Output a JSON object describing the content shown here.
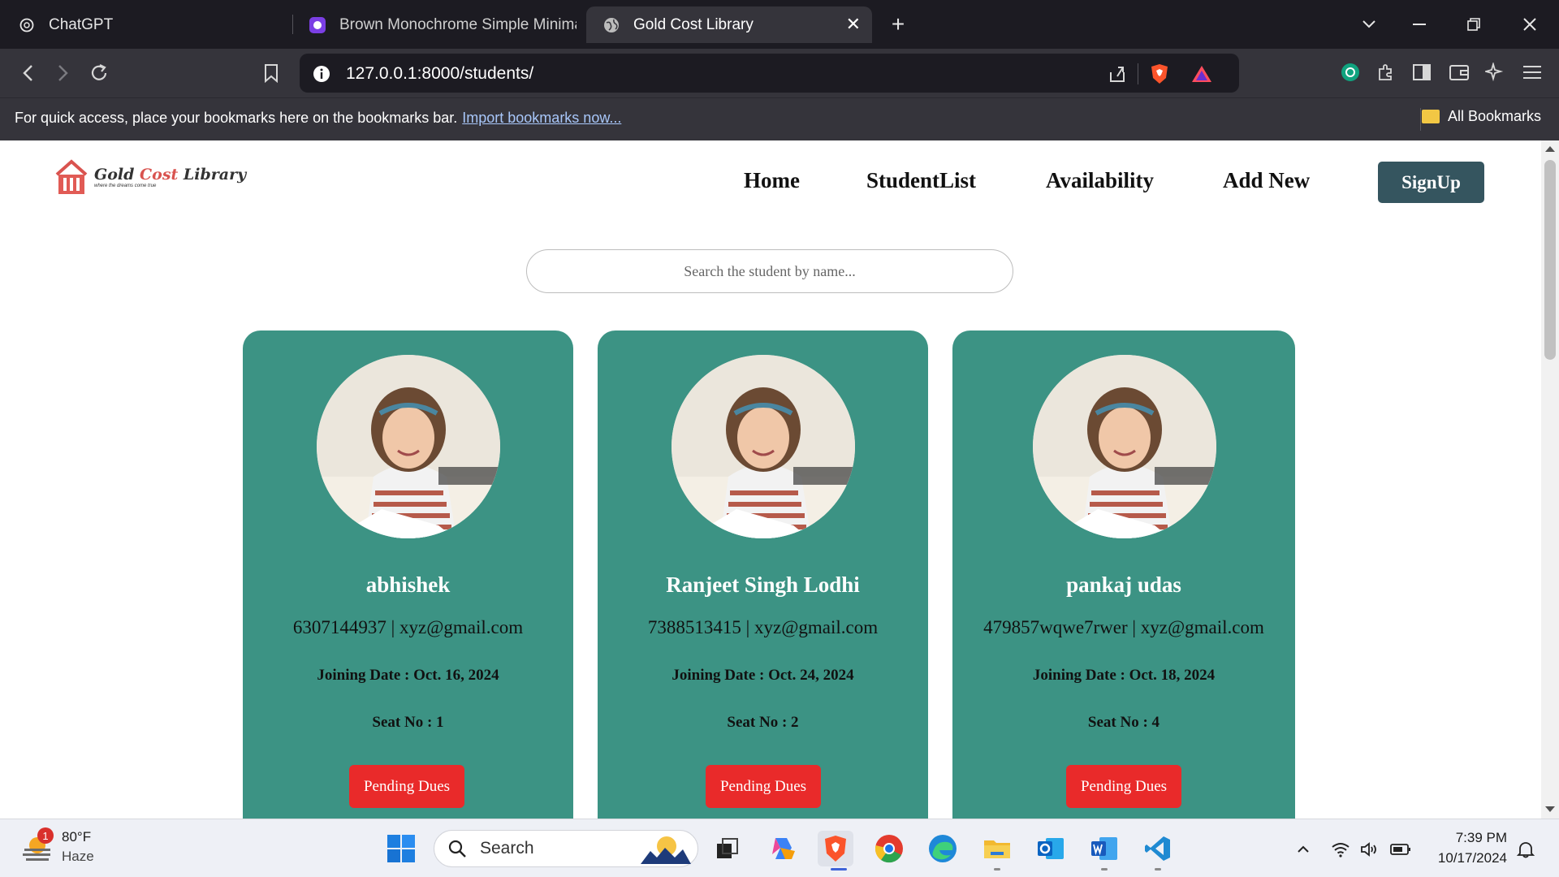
{
  "browser": {
    "tabs": [
      {
        "title": "ChatGPT",
        "icon": "chatgpt-icon",
        "active": false
      },
      {
        "title": "Brown Monochrome Simple Minima",
        "icon": "canva-icon",
        "active": false
      },
      {
        "title": "Gold Cost Library",
        "icon": "globe-icon",
        "active": true
      }
    ],
    "url": "127.0.0.1:8000/students/",
    "bookmarks_bar": {
      "message": "For quick access, place your bookmarks here on the bookmarks bar.",
      "import_link": "Import bookmarks now...",
      "all_bookmarks": "All Bookmarks"
    }
  },
  "site": {
    "logo": {
      "name_part1": "Gold ",
      "name_part2": "Cost",
      "name_part3": " Library",
      "tagline": "where the dreams come true"
    },
    "nav": {
      "home": "Home",
      "students": "StudentList",
      "availability": "Availability",
      "add_new": "Add New",
      "signup": "SignUp"
    },
    "search_placeholder": "Search the student by name...",
    "students": [
      {
        "name": "abhishek",
        "contact": "6307144937 | xyz@gmail.com",
        "joining": "Joining Date : Oct. 16, 2024",
        "seat": "Seat No : 1",
        "dues": "Pending Dues"
      },
      {
        "name": "Ranjeet Singh Lodhi",
        "contact": "7388513415 | xyz@gmail.com",
        "joining": "Joining Date : Oct. 24, 2024",
        "seat": "Seat No : 2",
        "dues": "Pending Dues"
      },
      {
        "name": "pankaj udas",
        "contact": "479857wqwe7rwer | xyz@gmail.com",
        "joining": "Joining Date : Oct. 18, 2024",
        "seat": "Seat No : 4",
        "dues": "Pending Dues"
      }
    ],
    "colors": {
      "card": "#3c9384",
      "signup": "#35555f",
      "dues": "#e92a2a"
    }
  },
  "taskbar": {
    "weather": {
      "temp": "80°F",
      "condition": "Haze",
      "badge": "1"
    },
    "search_label": "Search",
    "time": "7:39 PM",
    "date": "10/17/2024"
  }
}
